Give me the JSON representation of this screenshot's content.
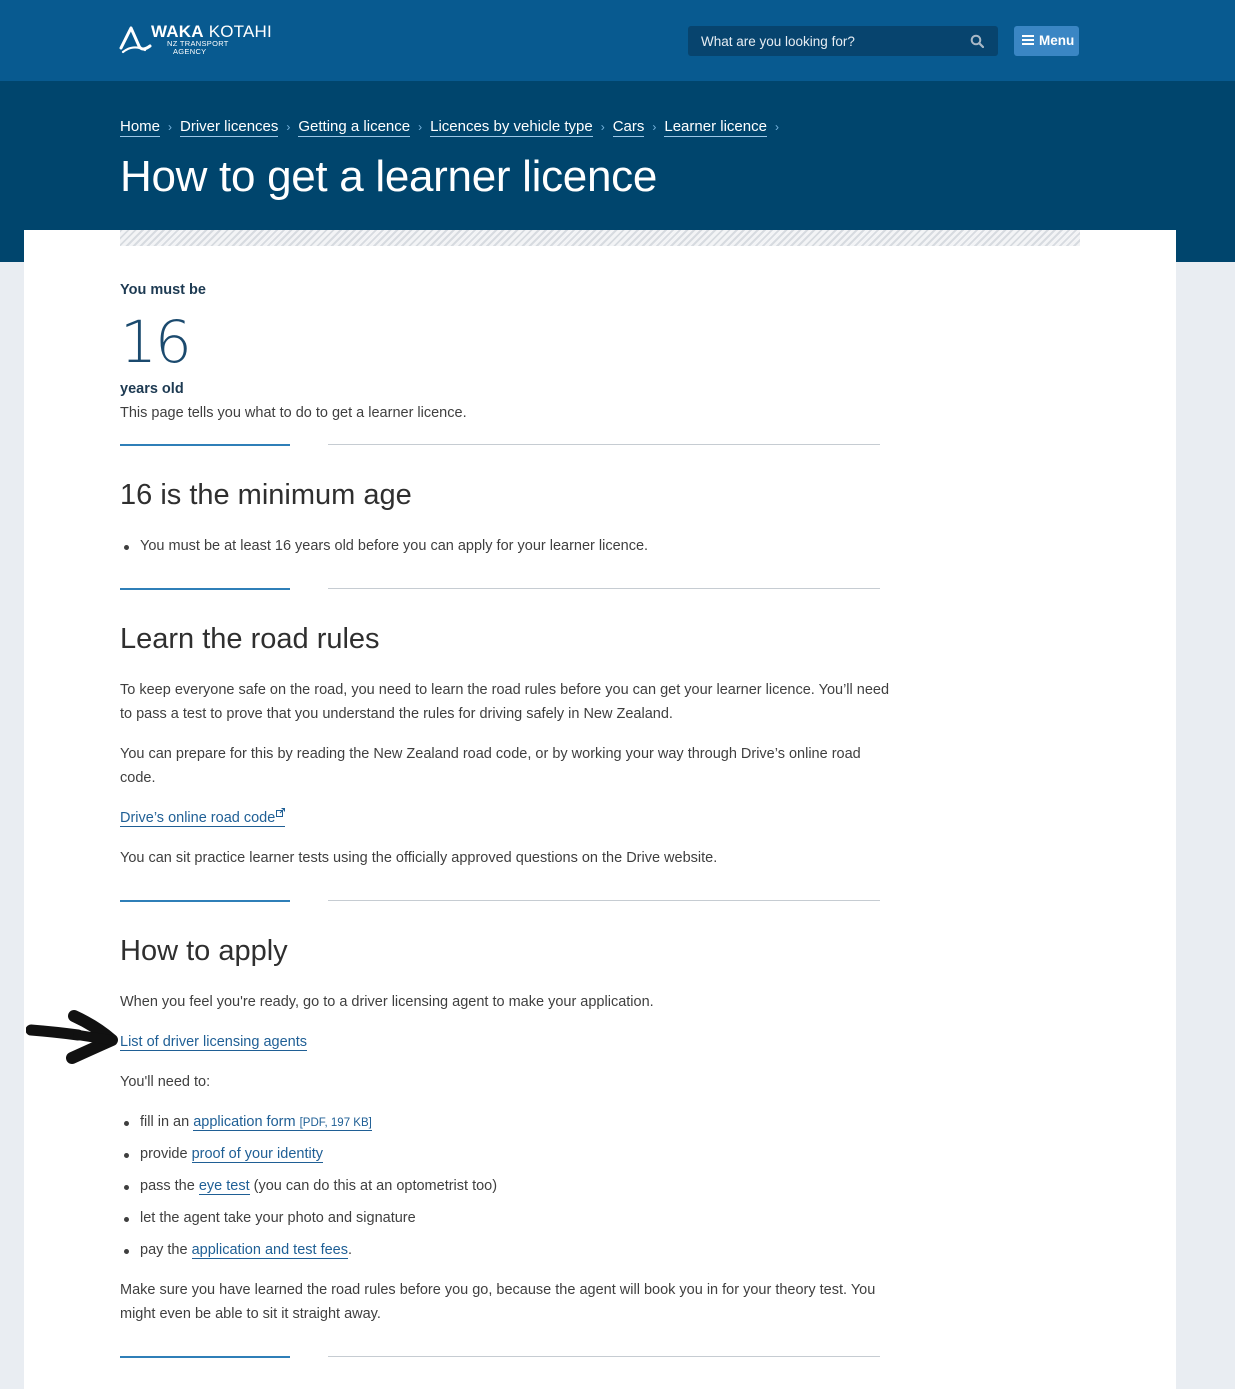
{
  "header": {
    "logo": {
      "name": "WAKA KOTAHI",
      "bold_part": "WAKA",
      "light_part": "KOTAHI",
      "sub_line1": "NZ TRANSPORT",
      "sub_line2": "AGENCY"
    },
    "search_placeholder": "What are you looking for?",
    "search_icon": "search-icon",
    "menu_label": "Menu",
    "menu_icon": "hamburger-icon",
    "colors": {
      "topbar": "#085a90",
      "hero": "#00456d",
      "menu_button": "#3a86c4"
    }
  },
  "breadcrumb": [
    {
      "label": "Home"
    },
    {
      "label": "Driver licences"
    },
    {
      "label": "Getting a licence"
    },
    {
      "label": "Licences by vehicle type"
    },
    {
      "label": "Cars"
    },
    {
      "label": "Learner licence"
    }
  ],
  "page_title": "How to get a learner licence",
  "summary": {
    "must_be": "You must be",
    "age": "16",
    "years_old": "years old",
    "intro": "This page tells you what to do to get a learner licence."
  },
  "sections": {
    "min_age": {
      "heading": "16 is the minimum age",
      "bullet": "You must be at least 16 years old before you can apply for your learner licence."
    },
    "road_rules": {
      "heading": "Learn the road rules",
      "para1": "To keep everyone safe on the road, you need to learn the road rules before you can get your learner licence. You’ll need to pass a test to prove that you understand the rules for driving safely in New Zealand.",
      "para2": "You can prepare for this by reading the New Zealand road code, or by working your way through Drive’s online road code.",
      "link": "Drive’s online road code",
      "para3": "You can sit practice learner tests using the officially approved questions on the Drive website."
    },
    "apply": {
      "heading": "How to apply",
      "para1": "When you feel you're ready, go to a driver licensing agent to make your application.",
      "agents_link": "List of driver licensing agents",
      "need_to": "You'll need to:",
      "items": [
        {
          "before": "fill in an ",
          "link": "application form",
          "meta": "[PDF, 197 KB]",
          "after": ""
        },
        {
          "before": "provide ",
          "link": "proof of your identity",
          "meta": "",
          "after": ""
        },
        {
          "before": "pass the ",
          "link": "eye test",
          "meta": "",
          "after": " (you can do this at an optometrist too)"
        },
        {
          "before": "let the agent take your photo and signature",
          "link": "",
          "meta": "",
          "after": ""
        },
        {
          "before": "pay the ",
          "link": "application and test fees",
          "meta": "",
          "after": "."
        }
      ],
      "closing": "Make sure you have learned the road rules before you go, because the agent will book you in for your theory test. You might even be able to sit it straight away."
    }
  },
  "annotation_icon": "hand-drawn-arrow-icon"
}
